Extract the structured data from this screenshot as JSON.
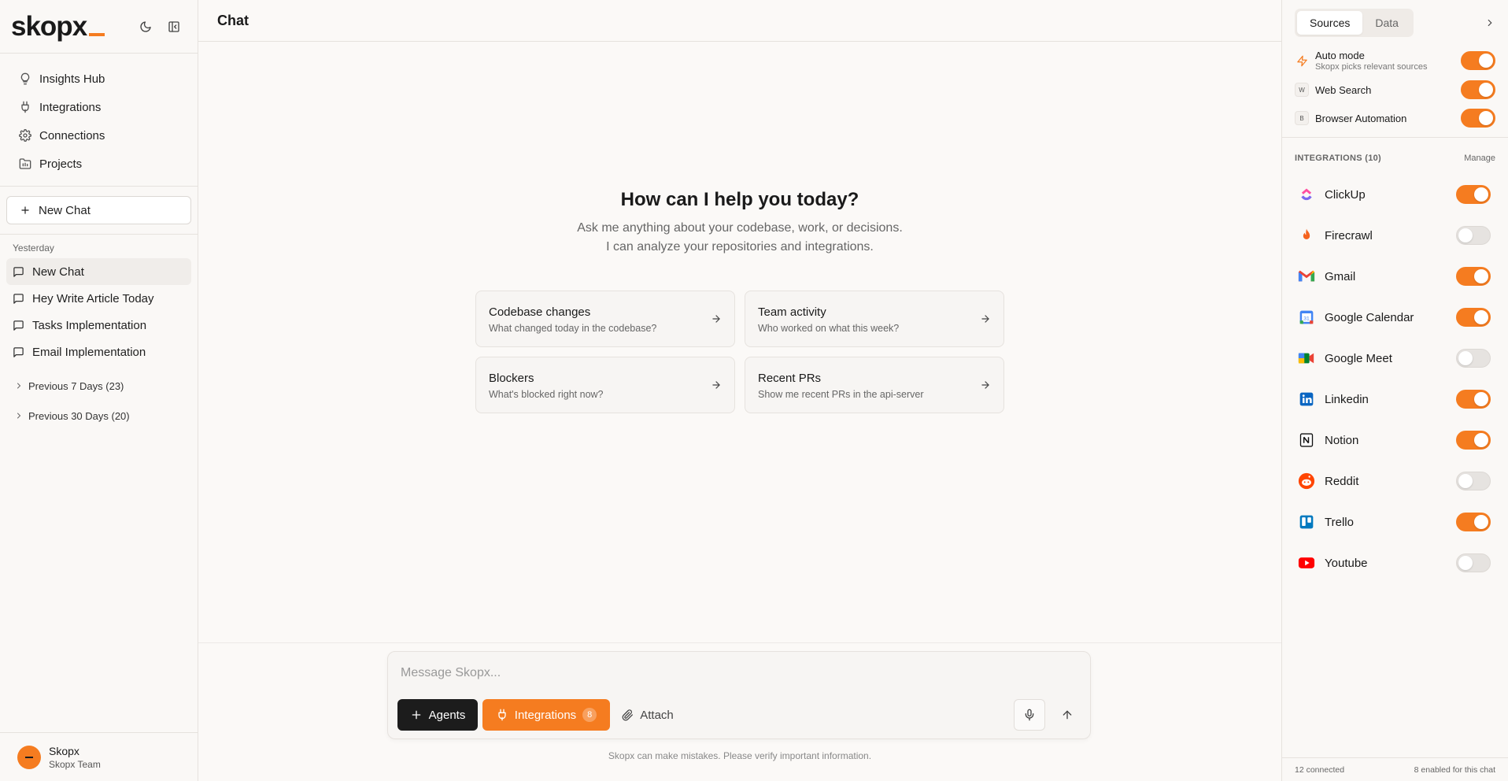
{
  "app": {
    "logo": "skopx"
  },
  "nav": [
    {
      "label": "Insights Hub",
      "icon": "lightbulb-icon"
    },
    {
      "label": "Integrations",
      "icon": "plug-icon"
    },
    {
      "label": "Connections",
      "icon": "gear-icon"
    },
    {
      "label": "Projects",
      "icon": "folder-icon"
    }
  ],
  "new_chat_label": "New Chat",
  "history": {
    "heading": "Yesterday",
    "items": [
      {
        "label": "New Chat",
        "active": true
      },
      {
        "label": "Hey Write Article Today",
        "active": false
      },
      {
        "label": "Tasks Implementation",
        "active": false
      },
      {
        "label": "Email Implementation",
        "active": false
      }
    ],
    "groups": [
      {
        "label": "Previous 7 Days (23)"
      },
      {
        "label": "Previous 30 Days (20)"
      }
    ]
  },
  "user": {
    "name": "Skopx",
    "team": "Skopx Team"
  },
  "main": {
    "title": "Chat",
    "welcome_title": "How can I help you today?",
    "welcome_line1": "Ask me anything about your codebase, work, or decisions.",
    "welcome_line2": "I can analyze your repositories and integrations.",
    "cards": [
      {
        "title": "Codebase changes",
        "subtitle": "What changed today in the codebase?"
      },
      {
        "title": "Team activity",
        "subtitle": "Who worked on what this week?"
      },
      {
        "title": "Blockers",
        "subtitle": "What's blocked right now?"
      },
      {
        "title": "Recent PRs",
        "subtitle": "Show me recent PRs in the api-server"
      }
    ]
  },
  "composer": {
    "placeholder": "Message Skopx...",
    "agents_label": "Agents",
    "integrations_label": "Integrations",
    "integrations_count": "8",
    "attach_label": "Attach",
    "disclaimer": "Skopx can make mistakes. Please verify important information."
  },
  "panel": {
    "tabs": [
      {
        "label": "Sources",
        "active": true
      },
      {
        "label": "Data",
        "active": false
      }
    ],
    "sources": [
      {
        "name": "Auto mode",
        "desc": "Skopx picks relevant sources",
        "icon": "lightning-icon",
        "enabled": true
      },
      {
        "name": "Web Search",
        "letter": "W",
        "enabled": true
      },
      {
        "name": "Browser Automation",
        "letter": "B",
        "enabled": true
      }
    ],
    "integrations_title": "INTEGRATIONS (10)",
    "manage_label": "Manage",
    "integrations": [
      {
        "name": "ClickUp",
        "icon": "clickup-icon",
        "enabled": true
      },
      {
        "name": "Firecrawl",
        "icon": "firecrawl-icon",
        "enabled": false
      },
      {
        "name": "Gmail",
        "icon": "gmail-icon",
        "enabled": true
      },
      {
        "name": "Google Calendar",
        "icon": "google-calendar-icon",
        "enabled": true
      },
      {
        "name": "Google Meet",
        "icon": "google-meet-icon",
        "enabled": false
      },
      {
        "name": "Linkedin",
        "icon": "linkedin-icon",
        "enabled": true
      },
      {
        "name": "Notion",
        "icon": "notion-icon",
        "enabled": true
      },
      {
        "name": "Reddit",
        "icon": "reddit-icon",
        "enabled": false
      },
      {
        "name": "Trello",
        "icon": "trello-icon",
        "enabled": true
      },
      {
        "name": "Youtube",
        "icon": "youtube-icon",
        "enabled": false
      }
    ],
    "footer_left": "12 connected",
    "footer_right": "8 enabled for this chat"
  },
  "colors": {
    "accent": "#f57c20",
    "dark": "#1c1c1c",
    "background": "#fbf9f7"
  }
}
